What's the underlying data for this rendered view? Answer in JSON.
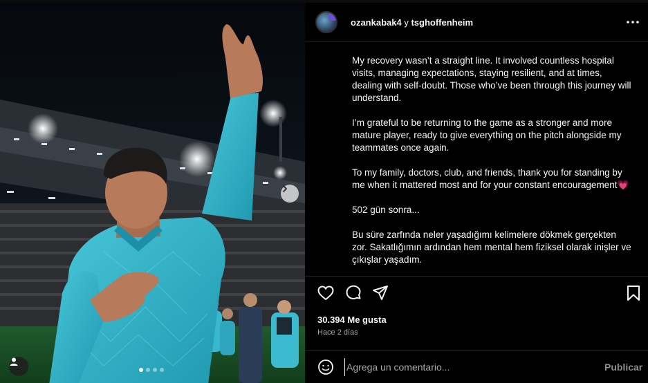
{
  "post": {
    "header": {
      "username": "ozankabak4",
      "conjunction": "y",
      "collaborator": "tsghoffenheim"
    },
    "caption": [
      "My recovery wasn’t a straight line. It involved countless hospital visits, managing expectations, staying resilient, and at times, dealing with self-doubt. Those who’ve been through this journey will understand.",
      "I’m grateful to be returning to the game as a stronger and more mature player, ready to give everything on the pitch alongside my teammates once again.",
      "To my family, doctors, club, and friends, thank you for standing by me when it mattered most and for your constant encouragement",
      "502 gün sonra...",
      "Bu süre zarfında neler yaşadığımı kelimelere dökmek gerçekten zor. Sakatlığımın ardından hem mental hem fiziksel olarak inişler ve çıkışlar yaşadım."
    ],
    "caption_emoji": "💗",
    "likes_text": "30.394 Me gusta",
    "time_text": "Hace 2 días",
    "comment": {
      "placeholder": "Agrega un comentario...",
      "post_label": "Publicar"
    },
    "carousel": {
      "slide_count": 4,
      "active_index": 0
    }
  },
  "colors": {
    "background": "#000000",
    "text": "#f5f5f5",
    "muted": "#a8a8a8",
    "jersey": "#2fb3c8",
    "divider": "#262626"
  },
  "icons": [
    "more-icon",
    "chevron-right-icon",
    "user-tag-icon",
    "heart-icon",
    "comment-icon",
    "share-icon",
    "bookmark-icon",
    "emoji-icon"
  ]
}
